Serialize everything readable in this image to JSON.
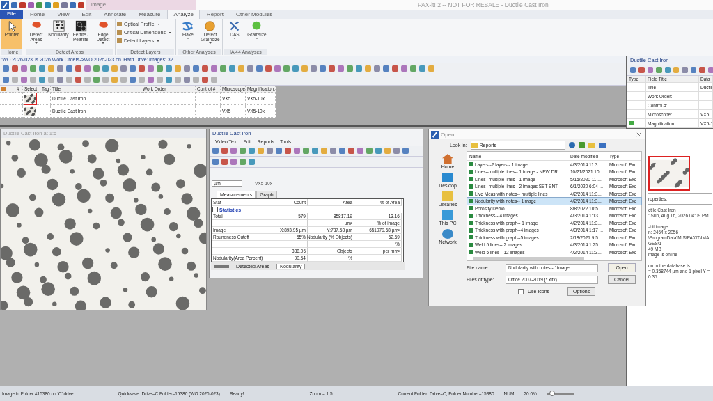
{
  "title_bar": {
    "context_tab": "Image",
    "title": "PAX-it! 2 -- NOT FOR RESALE - Ductile Cast Iron"
  },
  "ribbon_tabs": [
    {
      "label": "File",
      "kind": "file",
      "selected": false
    },
    {
      "label": "Home",
      "kind": "tab",
      "selected": false
    },
    {
      "label": "View",
      "kind": "tab",
      "selected": false
    },
    {
      "label": "Edit",
      "kind": "tab",
      "selected": false
    },
    {
      "label": "Annotate",
      "kind": "tab",
      "selected": false
    },
    {
      "label": "Measure",
      "kind": "tab",
      "selected": false
    },
    {
      "label": "Analyze",
      "kind": "tab",
      "selected": true
    },
    {
      "label": "Report",
      "kind": "tab",
      "selected": false
    },
    {
      "label": "Other Modules",
      "kind": "tab",
      "selected": false
    }
  ],
  "ribbon_groups": [
    {
      "label": "Home",
      "items": [
        {
          "label": "Pointer",
          "kind": "large",
          "active": true,
          "dropdown": false
        }
      ]
    },
    {
      "label": "Detect Areas",
      "items": [
        {
          "label": "Detect Areas",
          "kind": "large",
          "active": false,
          "dropdown": true
        },
        {
          "label": "Nodularity",
          "kind": "large",
          "active": false,
          "dropdown": true
        },
        {
          "label": "Ferrite / Pearlite",
          "kind": "large",
          "active": false,
          "dropdown": false
        },
        {
          "label": "Edge Detect",
          "kind": "large",
          "active": false,
          "dropdown": true
        }
      ]
    },
    {
      "label": "Detect Layers",
      "items": [
        {
          "label": "Optical Profile",
          "kind": "small",
          "dropdown": true
        },
        {
          "label": "Critical Dimensions",
          "kind": "small",
          "dropdown": true
        },
        {
          "label": "Detect Layers",
          "kind": "small",
          "dropdown": true
        }
      ]
    },
    {
      "label": "Other Analyses",
      "items": [
        {
          "label": "Flake",
          "kind": "large",
          "active": false,
          "dropdown": true
        },
        {
          "label": "Detect Grainsize",
          "kind": "large",
          "active": false,
          "dropdown": true
        }
      ]
    },
    {
      "label": "IA 44 Analyses",
      "items": [
        {
          "label": "DAS",
          "kind": "large",
          "active": false,
          "dropdown": true
        },
        {
          "label": "Grainsize",
          "kind": "large",
          "active": false,
          "dropdown": true
        }
      ]
    }
  ],
  "browser": {
    "breadcrumb": "'WO 2026-023' is 2026 Work Orders->WO 2026-023 on 'Hard Drive' Images: 32",
    "columns": [
      "#",
      "Select",
      "Tag",
      "Title",
      "Work Order",
      "Control #",
      "Microscope:",
      "Magnification:"
    ],
    "rows": [
      {
        "title": "Ductile Cast Iron",
        "microscope": "VX5",
        "magnification": "VX5-10x",
        "selected": true
      },
      {
        "title": "Ductile Cast Iron",
        "microscope": "VX5",
        "magnification": "VX5-10x",
        "selected": false
      }
    ]
  },
  "image_window": {
    "title": "Ductile Cast Iron at 1:5"
  },
  "stats_window": {
    "title": "Ductile Cast Iron",
    "menu": [
      "Video Text",
      "Edit",
      "Reports",
      "Tools"
    ],
    "unit": "µm",
    "objective": "VX5-10x",
    "tabs": [
      {
        "label": "Measurements",
        "selected": true
      },
      {
        "label": "Graph",
        "selected": false
      }
    ],
    "columns": [
      "Stat",
      "Count",
      "Area",
      "% of Area"
    ],
    "group": {
      "label": "Statistics",
      "expanded": true
    },
    "rows": [
      [
        "Total",
        "579",
        "85817.19",
        "13.16"
      ],
      [
        "",
        "",
        "µm²",
        "% of image"
      ],
      [
        "Image",
        "X:893.95 µm",
        "Y:737.58 µm",
        "651979.68 µm²"
      ],
      [
        "Roundness Cutoff",
        "55%",
        "Nodularity (% Objects)",
        "62.69"
      ],
      [
        "",
        "",
        "",
        "%"
      ],
      [
        "",
        "888.06",
        "Objects",
        "per mm²"
      ],
      [
        "Nodularity(Area Percent)",
        "90.54",
        "%",
        ""
      ]
    ],
    "sheets": [
      {
        "label": "Detected Areas",
        "selected": false
      },
      {
        "label": "Nodularity",
        "selected": true
      }
    ]
  },
  "open_dialog": {
    "title": "Open",
    "look_in_label": "Look in:",
    "look_in": "Reports",
    "places": [
      "Home",
      "Desktop",
      "Libraries",
      "This PC",
      "Network"
    ],
    "columns": [
      "Name",
      "Date modified",
      "Type"
    ],
    "files": [
      {
        "name": "Layers--2 layers-- 1 image",
        "date": "4/3/2014 11:3...",
        "type": "Microsoft Exc",
        "selected": false
      },
      {
        "name": "Lines--multiple lines-- 1 image - NEW DR...",
        "date": "10/21/2021 10...",
        "type": "Microsoft Exc",
        "selected": false
      },
      {
        "name": "Lines--multiple lines-- 1 image",
        "date": "5/15/2020 11:...",
        "type": "Microsoft Exc",
        "selected": false
      },
      {
        "name": "Lines--multiple lines-- 2 images SET ENT",
        "date": "6/1/2020 6:04 ...",
        "type": "Microsoft Exc",
        "selected": false
      },
      {
        "name": "Live Meas with notes-- multiple lines",
        "date": "4/2/2014 11:3...",
        "type": "Microsoft Exc",
        "selected": false
      },
      {
        "name": "Nodularity with notes-- 1image",
        "date": "4/2/2014 11:3...",
        "type": "Microsoft Exc",
        "selected": true
      },
      {
        "name": "Porosity Demo",
        "date": "8/8/2022 10:5...",
        "type": "Microsoft Exc",
        "selected": false
      },
      {
        "name": "Thickness-- 4 images",
        "date": "4/3/2014 1:13 ...",
        "type": "Microsoft Exc",
        "selected": false
      },
      {
        "name": "Thickness with graph-- 1 image",
        "date": "4/2/2014 11:3...",
        "type": "Microsoft Exc",
        "selected": false
      },
      {
        "name": "Thickness with graph--4 images",
        "date": "4/3/2014 1:17 ...",
        "type": "Microsoft Exc",
        "selected": false
      },
      {
        "name": "Thickness with graph--5 images",
        "date": "2/18/2021 9:5...",
        "type": "Microsoft Exc",
        "selected": false
      },
      {
        "name": "Weld 5 lines-- 2 images",
        "date": "4/3/2014 1:25 ...",
        "type": "Microsoft Exc",
        "selected": false
      },
      {
        "name": "Weld 5 lines-- 12 images",
        "date": "4/2/2014 11:3...",
        "type": "Microsoft Exc",
        "selected": false
      }
    ],
    "file_name_label": "File name:",
    "file_name": "Nodularity with notes-- 1image",
    "file_type_label": "Files of type:",
    "file_type": "Office 2007-2019 (*.xltx)",
    "use_icons": {
      "label": "Use Icons",
      "checked": false
    },
    "buttons": {
      "open": "Open",
      "cancel": "Cancel",
      "options": "Options"
    }
  },
  "properties_panel": {
    "title": "Ductile Cast Iron",
    "columns": [
      "Type",
      "Field Title",
      "Data"
    ],
    "fields": [
      {
        "label": "Title",
        "value": "Ductil",
        "marked": false
      },
      {
        "label": "Work Order:",
        "marked": false
      },
      {
        "label": "Control #:",
        "marked": false
      },
      {
        "label": "Microscope:",
        "value": "VX5",
        "marked": false
      },
      {
        "label": "Magnification:",
        "value": "VX5-1",
        "marked": true
      }
    ],
    "sections": [
      [
        "roperties:"
      ],
      [
        "ctile Cast Iron",
        ": Sun, Aug 16, 2026 04:09 PM"
      ],
      [
        "-bit image",
        "n: 2464 x 2056",
        "\\ProgramData\\MIS\\PAXIT\\IMAGES\\1",
        "49 MB",
        "mage is online"
      ],
      [
        "on in the database is:",
        "= 0.358744 µm and 1 pixel Y = 0.35"
      ]
    ]
  },
  "status_bar": {
    "left": "Image in Folder #15380 on 'C' drive",
    "quicksave": "Quicksave: Drive=C Folder=15380 (WO 2026-023)",
    "state": "Ready!",
    "zoom": "Zoom = 1:5",
    "folder": "Current Folder: Drive=C, Folder Number=15380",
    "num": "NUM",
    "percent": "20.0%",
    "level": 0.1
  }
}
